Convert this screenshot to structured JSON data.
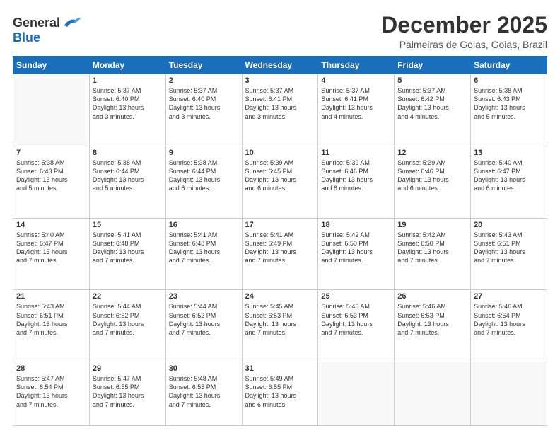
{
  "logo": {
    "text_general": "General",
    "text_blue": "Blue"
  },
  "header": {
    "title": "December 2025",
    "subtitle": "Palmeiras de Goias, Goias, Brazil"
  },
  "calendar": {
    "days_of_week": [
      "Sunday",
      "Monday",
      "Tuesday",
      "Wednesday",
      "Thursday",
      "Friday",
      "Saturday"
    ],
    "weeks": [
      [
        {
          "day": "",
          "info": ""
        },
        {
          "day": "1",
          "info": "Sunrise: 5:37 AM\nSunset: 6:40 PM\nDaylight: 13 hours\nand 3 minutes."
        },
        {
          "day": "2",
          "info": "Sunrise: 5:37 AM\nSunset: 6:40 PM\nDaylight: 13 hours\nand 3 minutes."
        },
        {
          "day": "3",
          "info": "Sunrise: 5:37 AM\nSunset: 6:41 PM\nDaylight: 13 hours\nand 3 minutes."
        },
        {
          "day": "4",
          "info": "Sunrise: 5:37 AM\nSunset: 6:41 PM\nDaylight: 13 hours\nand 4 minutes."
        },
        {
          "day": "5",
          "info": "Sunrise: 5:37 AM\nSunset: 6:42 PM\nDaylight: 13 hours\nand 4 minutes."
        },
        {
          "day": "6",
          "info": "Sunrise: 5:38 AM\nSunset: 6:43 PM\nDaylight: 13 hours\nand 5 minutes."
        }
      ],
      [
        {
          "day": "7",
          "info": "Sunrise: 5:38 AM\nSunset: 6:43 PM\nDaylight: 13 hours\nand 5 minutes."
        },
        {
          "day": "8",
          "info": "Sunrise: 5:38 AM\nSunset: 6:44 PM\nDaylight: 13 hours\nand 5 minutes."
        },
        {
          "day": "9",
          "info": "Sunrise: 5:38 AM\nSunset: 6:44 PM\nDaylight: 13 hours\nand 6 minutes."
        },
        {
          "day": "10",
          "info": "Sunrise: 5:39 AM\nSunset: 6:45 PM\nDaylight: 13 hours\nand 6 minutes."
        },
        {
          "day": "11",
          "info": "Sunrise: 5:39 AM\nSunset: 6:46 PM\nDaylight: 13 hours\nand 6 minutes."
        },
        {
          "day": "12",
          "info": "Sunrise: 5:39 AM\nSunset: 6:46 PM\nDaylight: 13 hours\nand 6 minutes."
        },
        {
          "day": "13",
          "info": "Sunrise: 5:40 AM\nSunset: 6:47 PM\nDaylight: 13 hours\nand 6 minutes."
        }
      ],
      [
        {
          "day": "14",
          "info": "Sunrise: 5:40 AM\nSunset: 6:47 PM\nDaylight: 13 hours\nand 7 minutes."
        },
        {
          "day": "15",
          "info": "Sunrise: 5:41 AM\nSunset: 6:48 PM\nDaylight: 13 hours\nand 7 minutes."
        },
        {
          "day": "16",
          "info": "Sunrise: 5:41 AM\nSunset: 6:48 PM\nDaylight: 13 hours\nand 7 minutes."
        },
        {
          "day": "17",
          "info": "Sunrise: 5:41 AM\nSunset: 6:49 PM\nDaylight: 13 hours\nand 7 minutes."
        },
        {
          "day": "18",
          "info": "Sunrise: 5:42 AM\nSunset: 6:50 PM\nDaylight: 13 hours\nand 7 minutes."
        },
        {
          "day": "19",
          "info": "Sunrise: 5:42 AM\nSunset: 6:50 PM\nDaylight: 13 hours\nand 7 minutes."
        },
        {
          "day": "20",
          "info": "Sunrise: 5:43 AM\nSunset: 6:51 PM\nDaylight: 13 hours\nand 7 minutes."
        }
      ],
      [
        {
          "day": "21",
          "info": "Sunrise: 5:43 AM\nSunset: 6:51 PM\nDaylight: 13 hours\nand 7 minutes."
        },
        {
          "day": "22",
          "info": "Sunrise: 5:44 AM\nSunset: 6:52 PM\nDaylight: 13 hours\nand 7 minutes."
        },
        {
          "day": "23",
          "info": "Sunrise: 5:44 AM\nSunset: 6:52 PM\nDaylight: 13 hours\nand 7 minutes."
        },
        {
          "day": "24",
          "info": "Sunrise: 5:45 AM\nSunset: 6:53 PM\nDaylight: 13 hours\nand 7 minutes."
        },
        {
          "day": "25",
          "info": "Sunrise: 5:45 AM\nSunset: 6:53 PM\nDaylight: 13 hours\nand 7 minutes."
        },
        {
          "day": "26",
          "info": "Sunrise: 5:46 AM\nSunset: 6:53 PM\nDaylight: 13 hours\nand 7 minutes."
        },
        {
          "day": "27",
          "info": "Sunrise: 5:46 AM\nSunset: 6:54 PM\nDaylight: 13 hours\nand 7 minutes."
        }
      ],
      [
        {
          "day": "28",
          "info": "Sunrise: 5:47 AM\nSunset: 6:54 PM\nDaylight: 13 hours\nand 7 minutes."
        },
        {
          "day": "29",
          "info": "Sunrise: 5:47 AM\nSunset: 6:55 PM\nDaylight: 13 hours\nand 7 minutes."
        },
        {
          "day": "30",
          "info": "Sunrise: 5:48 AM\nSunset: 6:55 PM\nDaylight: 13 hours\nand 7 minutes."
        },
        {
          "day": "31",
          "info": "Sunrise: 5:49 AM\nSunset: 6:55 PM\nDaylight: 13 hours\nand 6 minutes."
        },
        {
          "day": "",
          "info": ""
        },
        {
          "day": "",
          "info": ""
        },
        {
          "day": "",
          "info": ""
        }
      ]
    ]
  }
}
